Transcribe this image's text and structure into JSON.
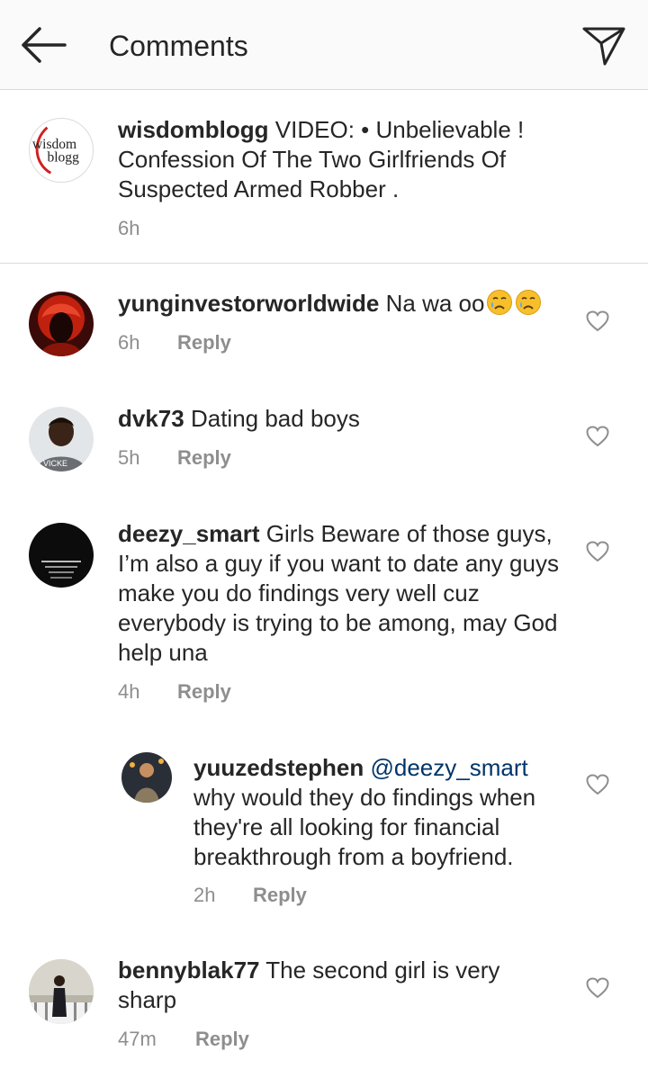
{
  "header": {
    "title": "Comments"
  },
  "post": {
    "username": "wisdomblogg",
    "caption": "VIDEO: • Unbelievable ! Confession Of The Two Girlfriends Of Suspected Armed Robber .",
    "time": "6h",
    "avatar_text": {
      "line1": "wisdom",
      "line2": "blogg"
    }
  },
  "comments": [
    {
      "username": "yunginvestorworldwide",
      "text": "Na wa oo",
      "emojis": [
        "crying-face",
        "crying-face"
      ],
      "time": "6h",
      "reply_label": "Reply"
    },
    {
      "username": "dvk73",
      "text": "Dating bad boys",
      "time": "5h",
      "reply_label": "Reply"
    },
    {
      "username": "deezy_smart",
      "text": "Girls Beware of those guys, I’m also a guy if you want to date any guys make you do findings very well cuz everybody is trying to be among, may God help una",
      "time": "4h",
      "reply_label": "Reply"
    },
    {
      "username": "yuuzedstephen",
      "mention": "@deezy_smart",
      "text": "why would they do findings when they're all looking for financial breakthrough from a boyfriend.",
      "time": "2h",
      "reply_label": "Reply",
      "is_reply": true
    },
    {
      "username": "bennyblak77",
      "text": "The second girl is very sharp",
      "time": "47m",
      "reply_label": "Reply"
    }
  ],
  "colors": {
    "text": "#262626",
    "secondary": "#8e8e8e",
    "mention": "#003569",
    "divider": "#dbdbdb",
    "header_bg": "#fafafa"
  }
}
